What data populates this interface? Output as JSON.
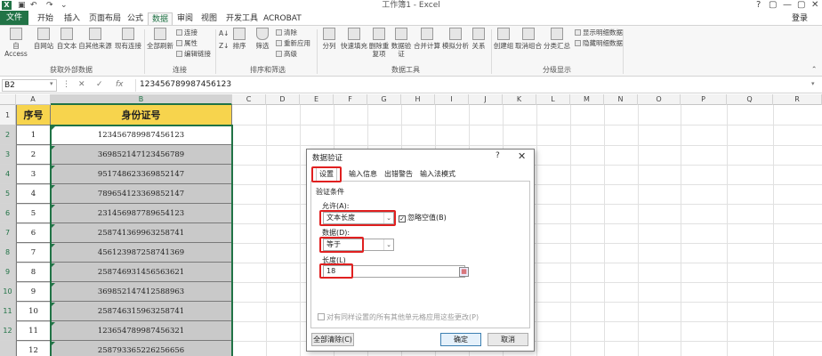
{
  "window": {
    "title": "工作簿1 - Excel",
    "app_logo": "X",
    "quick_access": [
      "save-icon",
      "undo-icon",
      "redo-icon",
      "customize-icon"
    ],
    "controls": [
      "?",
      "▢",
      "—",
      "▢",
      "✕"
    ],
    "login": "登录"
  },
  "tabs": [
    "文件",
    "开始",
    "插入",
    "页面布局",
    "公式",
    "数据",
    "审阅",
    "视图",
    "开发工具",
    "ACROBAT"
  ],
  "active_tab": "数据",
  "ribbon": {
    "get_external": {
      "items": [
        "自 Access",
        "自网站",
        "自文本",
        "自其他来源",
        "现有连接"
      ],
      "label": "获取外部数据"
    },
    "connections": {
      "refresh": "全部刷新",
      "small": [
        "连接",
        "属性",
        "编辑链接"
      ],
      "label": "连接"
    },
    "sort_filter": {
      "items": [
        "排序",
        "筛选"
      ],
      "small": [
        "清除",
        "重新应用",
        "高级"
      ],
      "sort_icons": [
        "A↓",
        "Z↓"
      ],
      "label": "排序和筛选"
    },
    "data_tools": {
      "items": [
        "分列",
        "快速填充",
        "删除重复项",
        "数据验证",
        "合并计算",
        "模拟分析",
        "关系"
      ],
      "label": "数据工具"
    },
    "outline": {
      "items": [
        "创建组",
        "取消组合",
        "分类汇总"
      ],
      "small": [
        "显示明细数据",
        "隐藏明细数据"
      ],
      "label": "分级显示"
    }
  },
  "formula_bar": {
    "name_box": "B2",
    "buttons": [
      "✕",
      "✓",
      "fx"
    ],
    "value": "123456789987456123"
  },
  "columns": [
    "A",
    "B",
    "C",
    "D",
    "E",
    "F",
    "G",
    "H",
    "I",
    "J",
    "K",
    "L",
    "M",
    "N",
    "O",
    "P",
    "Q",
    "R"
  ],
  "rows": [
    "1",
    "2",
    "3",
    "4",
    "5",
    "6",
    "7",
    "8",
    "9",
    "10",
    "11",
    "12"
  ],
  "table": {
    "headers": [
      "序号",
      "身份证号"
    ],
    "data": [
      [
        "1",
        "123456789987456123"
      ],
      [
        "2",
        "369852147123456789"
      ],
      [
        "3",
        "951748623369852147"
      ],
      [
        "4",
        "789654123369852147"
      ],
      [
        "5",
        "231456987789654123"
      ],
      [
        "6",
        "258741369963258741"
      ],
      [
        "7",
        "456123987258741369"
      ],
      [
        "8",
        "258746931456563621"
      ],
      [
        "9",
        "369852147412588963"
      ],
      [
        "10",
        "258746315963258741"
      ],
      [
        "11",
        "123654789987456321"
      ],
      [
        "12",
        "258793365226256656"
      ]
    ]
  },
  "dialog": {
    "title": "数据验证",
    "help": "?",
    "close": "✕",
    "tabs": [
      "设置",
      "输入信息",
      "出错警告",
      "输入法模式"
    ],
    "active_tab": "设置",
    "section": "验证条件",
    "allow_label": "允许(A):",
    "allow_value": "文本长度",
    "ignore_blank": "忽略空值(B)",
    "ignore_blank_checked": true,
    "data_label": "数据(D):",
    "data_value": "等于",
    "length_label": "长度(L)",
    "length_value": "18",
    "apply_all": "对有同样设置的所有其他单元格应用这些更改(P)",
    "clear_all": "全部清除(C)",
    "ok": "确定",
    "cancel": "取消",
    "highlight_color": "#e02020"
  }
}
